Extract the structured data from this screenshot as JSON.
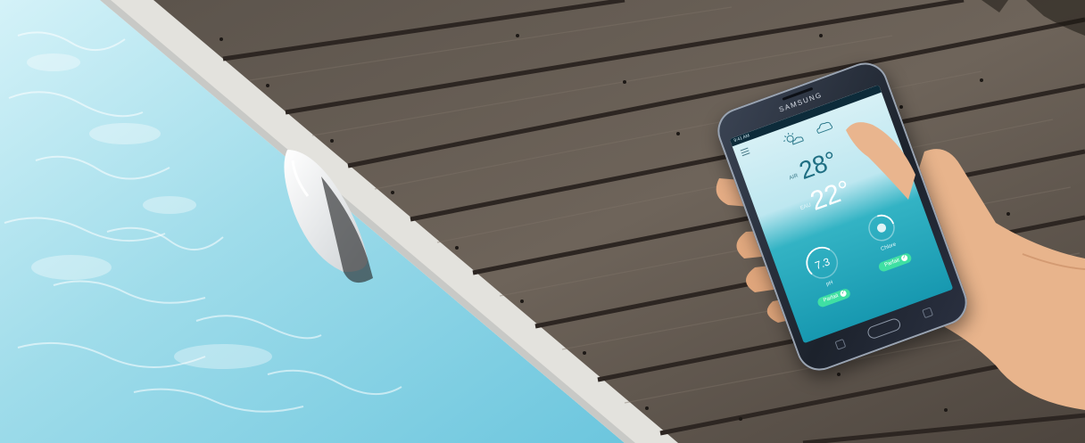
{
  "scene": {
    "description_colors": {
      "water_light": "#bfeaf3",
      "water_deep": "#5fc3dd",
      "coping": "#e2e1dc",
      "deck": "#6a5f55",
      "deck_dark": "#3a322c",
      "skin": "#e9b58e",
      "app_accent": "#3fe0a3"
    }
  },
  "phone": {
    "brand": "SAMSUNG",
    "status_time": "9:41 AM",
    "icons": [
      "menu-icon",
      "sun-cloud-icon",
      "cloud-icon",
      "check-icon"
    ],
    "app": {
      "air_label": "AIR",
      "air_temp": "28°",
      "water_label": "EAU",
      "water_temp": "22°",
      "ph_value": "7.3",
      "ph_label": "pH",
      "ph_status": "Parfait",
      "chlore_label": "Chlore",
      "chlore_status": "Parfait"
    }
  }
}
